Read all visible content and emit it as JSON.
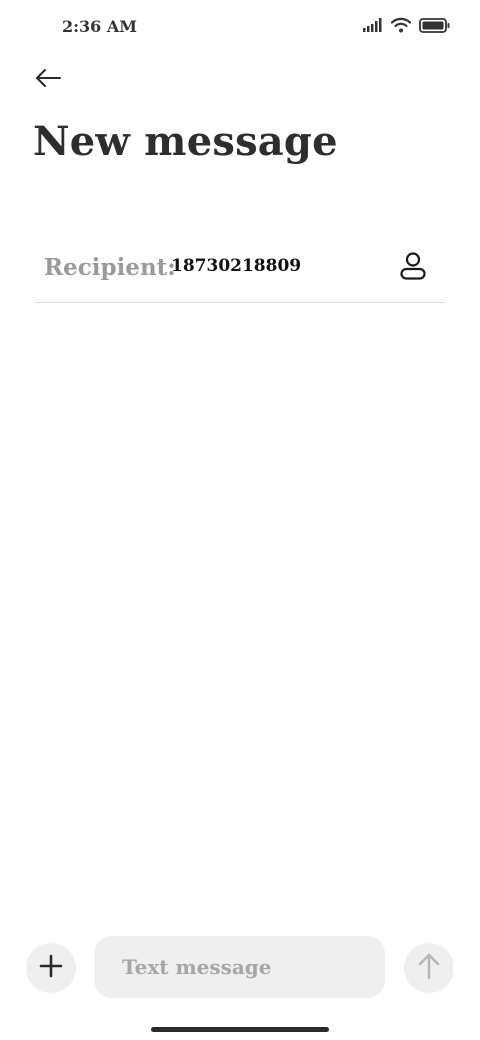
{
  "status_bar": {
    "time": "2:36 AM",
    "icons": [
      "signal-icon",
      "wifi-icon",
      "battery-icon"
    ]
  },
  "header": {
    "back_icon": "arrow-left-icon",
    "title": "New message"
  },
  "recipient": {
    "label": "Recipient:",
    "value": "18730218809",
    "contact_icon": "person-icon"
  },
  "composer": {
    "add_icon": "plus-icon",
    "placeholder": "Text message",
    "value": "",
    "send_icon": "arrow-up-icon"
  },
  "colors": {
    "text_primary": "#2e2e2e",
    "text_muted": "#9a9a9a",
    "field_bg": "#efefef",
    "divider": "#dcdcdc"
  }
}
